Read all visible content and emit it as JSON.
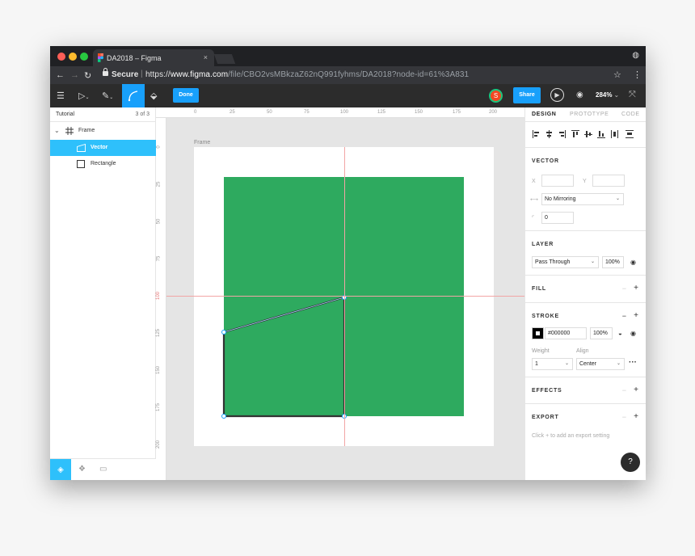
{
  "browser": {
    "tab_title": "DA2018 – Figma",
    "tab_close": "×",
    "secure_label": "Secure",
    "url_scheme": "https://",
    "url_host": "www.figma.com",
    "url_path": "/file/CBO2vsMBkzaZ62nQ991fyhms/DA2018?node-id=61%3A831",
    "colors": {
      "close": "#ff5f57",
      "minimize": "#febc2e",
      "maximize": "#28c840"
    }
  },
  "toolbar": {
    "done_label": "Done",
    "avatar_initial": "S",
    "share_label": "Share",
    "zoom_label": "284%",
    "accent_color": "#18a0fb"
  },
  "layers_panel": {
    "page_name": "Tutorial",
    "page_count": "3 of 3",
    "layers": [
      {
        "name": "Frame",
        "type": "frame"
      },
      {
        "name": "Vector",
        "type": "vector",
        "selected": true
      },
      {
        "name": "Rectangle",
        "type": "rectangle"
      }
    ]
  },
  "canvas": {
    "frame_label": "Frame",
    "fill_color": "#2eaa5f",
    "ruler_top": [
      "0",
      "25",
      "50",
      "75",
      "100",
      "125",
      "150",
      "175",
      "200"
    ],
    "ruler_left": [
      "0",
      "25",
      "50",
      "75",
      "100",
      "125",
      "150",
      "175",
      "200"
    ]
  },
  "properties_panel": {
    "tabs": [
      "DESIGN",
      "PROTOTYPE",
      "CODE"
    ],
    "vector": {
      "title": "VECTOR",
      "x_label": "X",
      "y_label": "Y",
      "mirroring": "No Mirroring",
      "corner_radius": "0"
    },
    "layer": {
      "title": "LAYER",
      "blend_mode": "Pass Through",
      "opacity": "100%"
    },
    "fill": {
      "title": "FILL"
    },
    "stroke": {
      "title": "STROKE",
      "color": "#000000",
      "opacity": "100%",
      "weight_label": "Weight",
      "align_label": "Align",
      "weight": "1",
      "align": "Center"
    },
    "effects": {
      "title": "EFFECTS"
    },
    "export": {
      "title": "EXPORT",
      "hint": "Click + to add an export setting"
    },
    "help_label": "?"
  }
}
